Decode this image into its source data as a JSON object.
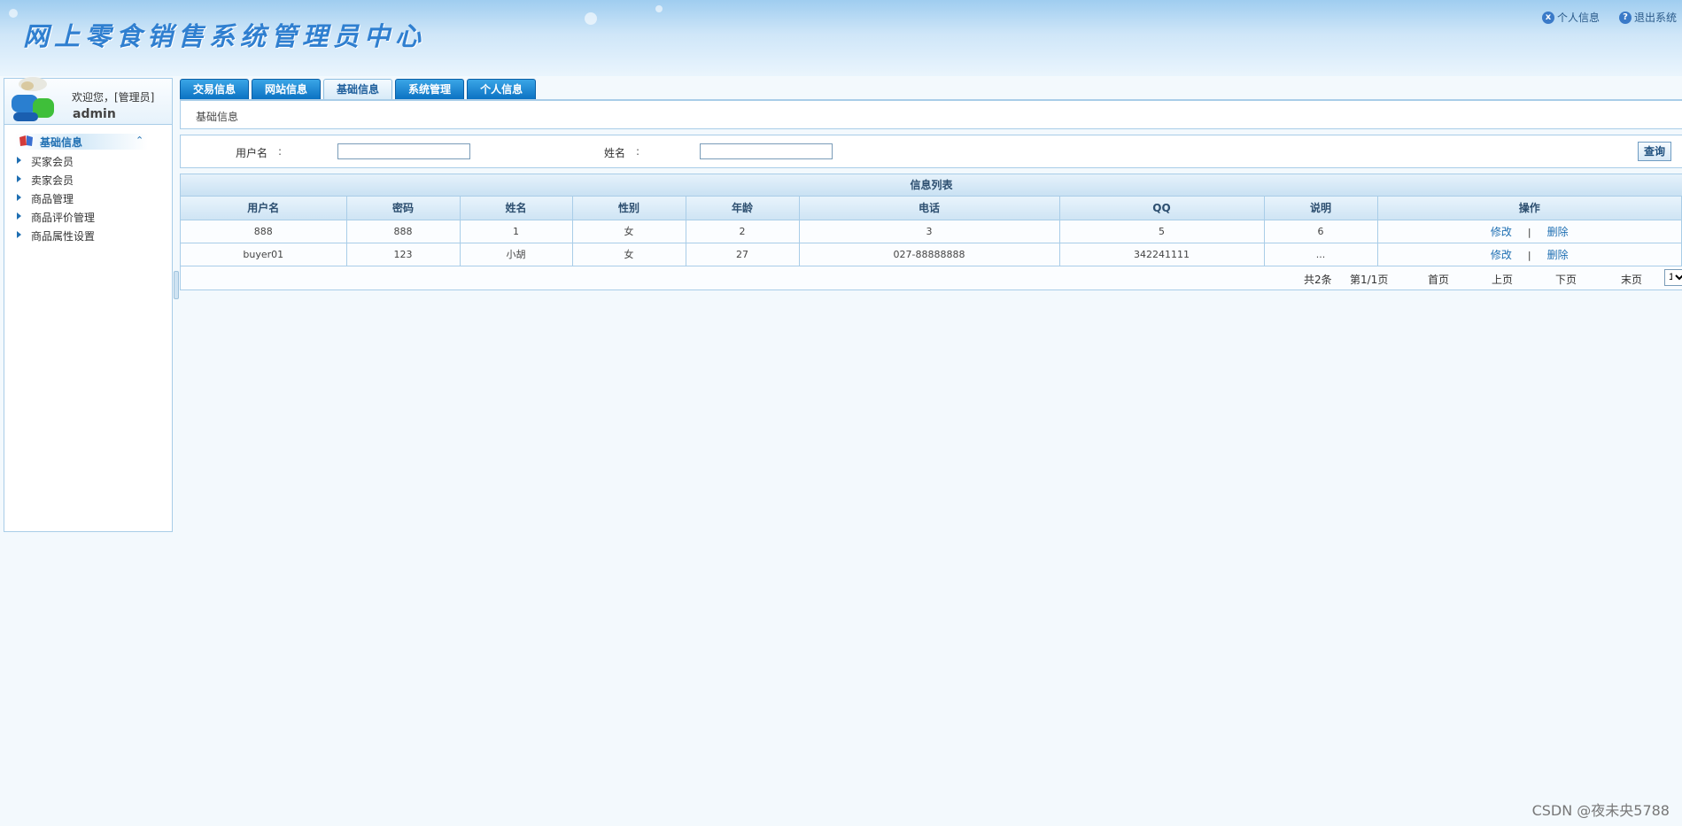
{
  "header": {
    "title": "网上零食销售系统管理员中心",
    "links": [
      {
        "label": "个人信息",
        "icon": "info-icon"
      },
      {
        "label": "退出系统",
        "icon": "help-icon"
      }
    ]
  },
  "sidebar": {
    "welcome": "欢迎您，[管理员]",
    "username": "admin",
    "section": "基础信息",
    "items": [
      "买家会员",
      "卖家会员",
      "商品管理",
      "商品评价管理",
      "商品属性设置"
    ]
  },
  "tabs": [
    {
      "label": "交易信息",
      "active": false
    },
    {
      "label": "网站信息",
      "active": false
    },
    {
      "label": "基础信息",
      "active": true
    },
    {
      "label": "系统管理",
      "active": false
    },
    {
      "label": "个人信息",
      "active": false
    }
  ],
  "breadcrumb": "基础信息",
  "search": {
    "username_label": "用户名",
    "name_label": "姓名",
    "colon": ":",
    "username_value": "",
    "name_value": "",
    "button": "查询"
  },
  "table": {
    "title": "信息列表",
    "columns": [
      "用户名",
      "密码",
      "姓名",
      "性别",
      "年龄",
      "电话",
      "QQ",
      "说明",
      "操作"
    ],
    "rows": [
      [
        "888",
        "888",
        "1",
        "女",
        "2",
        "3",
        "5",
        "6"
      ],
      [
        "buyer01",
        "123",
        "小胡",
        "女",
        "27",
        "027-88888888",
        "342241111",
        "..."
      ]
    ],
    "edit_label": "修改",
    "sep": "|",
    "delete_label": "删除"
  },
  "pager": {
    "total": "共2条",
    "page": "第1/1页",
    "first": "首页",
    "prev": "上页",
    "next": "下页",
    "last": "末页",
    "select_value": "1"
  },
  "watermark": "CSDN @夜未央5788"
}
